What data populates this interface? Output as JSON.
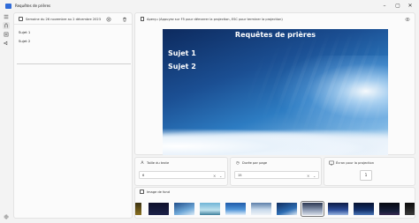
{
  "window": {
    "title": "Requêtes de prières"
  },
  "week": {
    "label": "Semaine du 26 novembre au 2 décembre 2023"
  },
  "topics": [
    "Sujet 1",
    "Sujet 2"
  ],
  "preview": {
    "label": "Aperçu (Appuyez sur F5 pour démarrer la projection, ESC pour terminer la projection)",
    "title": "Requêtes de prières"
  },
  "settings": {
    "text_size_label": "Taille du texte",
    "text_size_value": "6",
    "duration_label": "Durée par page",
    "duration_value": "15",
    "screen_label": "Écran pour la projection",
    "screen_value": "1"
  },
  "background": {
    "label": "Image de fond",
    "selected_index": 6
  },
  "colors": {
    "accent": "#2f6bd8",
    "screen_title": "#ffffff"
  }
}
